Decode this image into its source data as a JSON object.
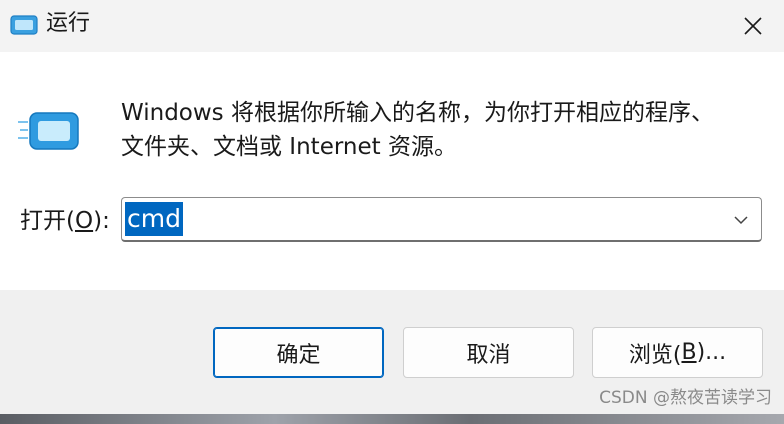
{
  "window": {
    "title": "运行"
  },
  "dialog": {
    "description_line1": "Windows 将根据你所输入的名称，为你打开相应的程序、",
    "description_line2": "文件夹、文档或 Internet 资源。",
    "open_label_prefix": "打开(",
    "open_label_hotkey": "O",
    "open_label_suffix": "):",
    "command_value": "cmd"
  },
  "buttons": {
    "ok": "确定",
    "cancel": "取消",
    "browse_prefix": "浏览(",
    "browse_hotkey": "B",
    "browse_suffix": ")..."
  },
  "watermark": "CSDN @熬夜苦读学习",
  "colors": {
    "accent": "#0067c0",
    "titlebar": "#f3f3f3",
    "footer": "#f0f0f0"
  },
  "icons": {
    "title": "run-app-icon",
    "close": "close-icon",
    "main": "run-app-icon",
    "dropdown": "chevron-down-icon"
  }
}
